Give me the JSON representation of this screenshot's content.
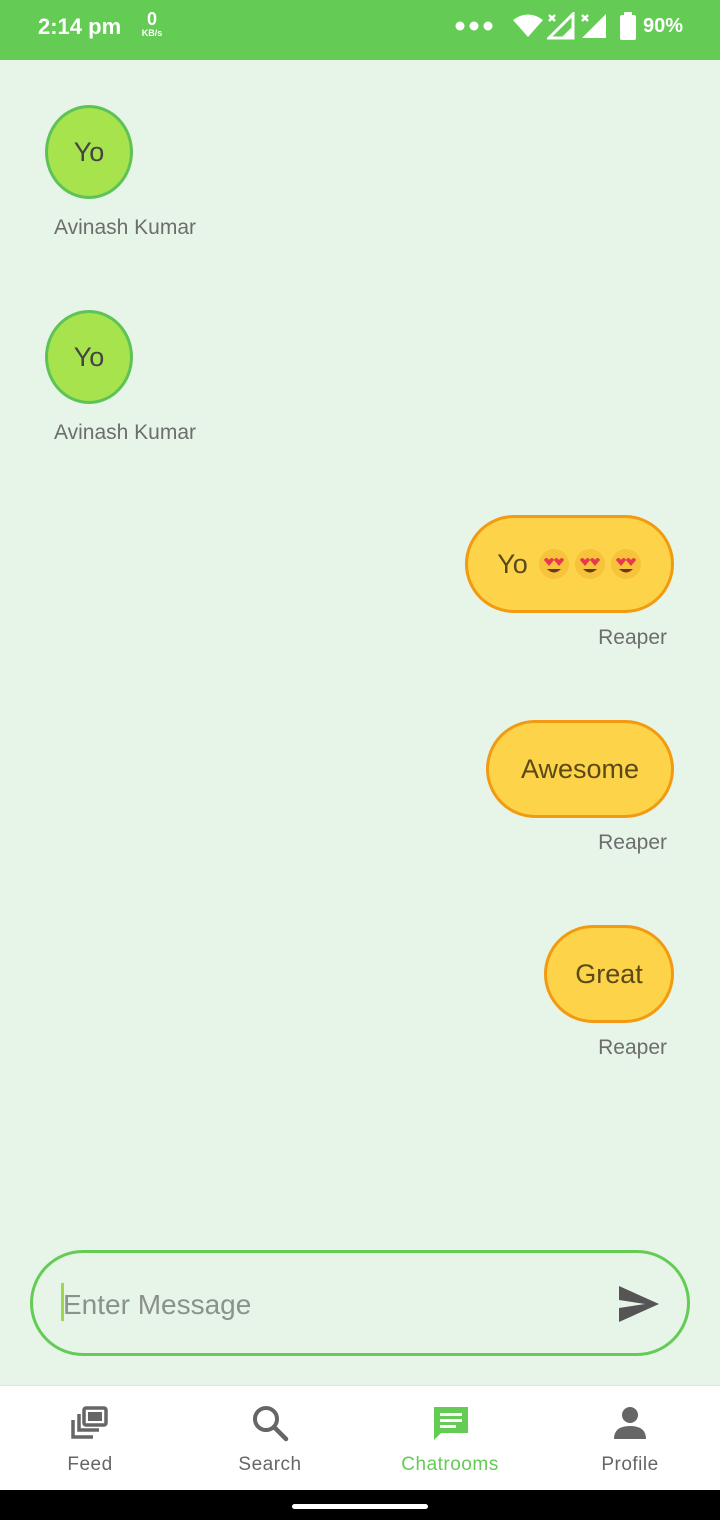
{
  "status_bar": {
    "time": "2:14 pm",
    "net_speed_value": "0",
    "net_speed_unit": "KB/s",
    "battery": "90%",
    "color": "#64cb55"
  },
  "messages": [
    {
      "text": "Yo",
      "sender": "Avinash Kumar",
      "side": "left"
    },
    {
      "text": "Yo",
      "sender": "Avinash Kumar",
      "side": "left"
    },
    {
      "text": "Yo",
      "sender": "Reaper",
      "side": "right",
      "emoji_count": 3,
      "emoji": "heart-eyes"
    },
    {
      "text": "Awesome",
      "sender": "Reaper",
      "side": "right"
    },
    {
      "text": "Great",
      "sender": "Reaper",
      "side": "right"
    }
  ],
  "composer": {
    "placeholder": "Enter Message",
    "value": ""
  },
  "bottom_nav": {
    "items": [
      {
        "label": "Feed",
        "icon": "feed-icon"
      },
      {
        "label": "Search",
        "icon": "search-icon"
      },
      {
        "label": "Chatrooms",
        "icon": "chat-icon",
        "active": true
      },
      {
        "label": "Profile",
        "icon": "person-icon"
      }
    ],
    "active_color": "#64cb55"
  },
  "colors": {
    "background": "#e6f5e7",
    "left_bubble": "#a6e34d",
    "right_bubble": "#fdd34a",
    "right_bubble_border": "#f29a10"
  }
}
